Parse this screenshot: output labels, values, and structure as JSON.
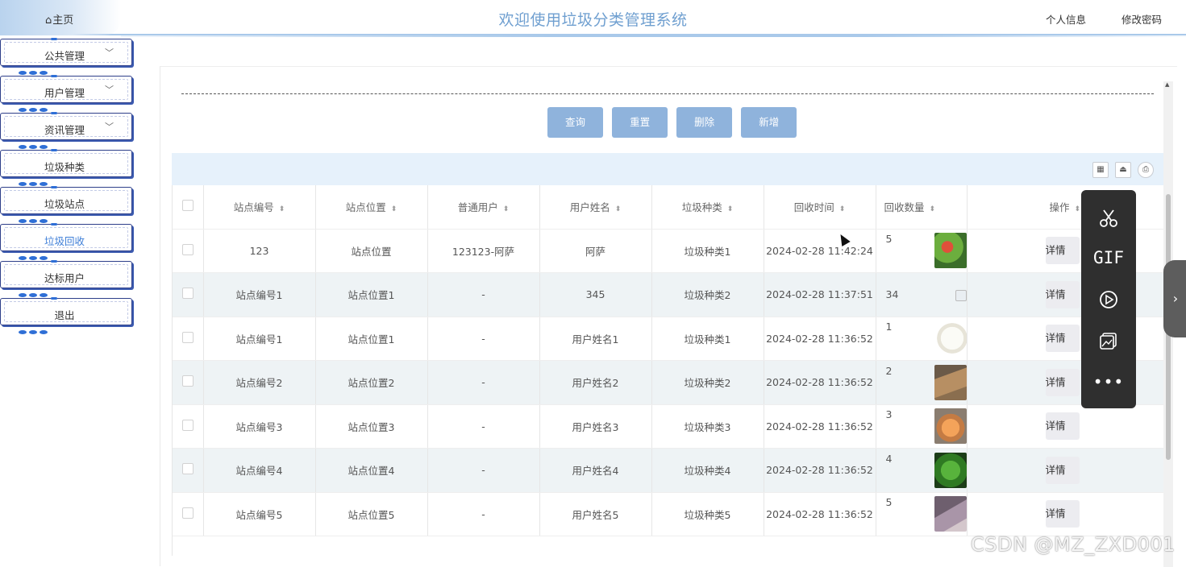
{
  "header": {
    "home_label": "主页",
    "title": "欢迎使用垃圾分类管理系统",
    "profile_label": "个人信息",
    "change_password_label": "修改密码"
  },
  "sidebar": {
    "items": [
      {
        "label": "公共管理",
        "has_submenu": true
      },
      {
        "label": "用户管理",
        "has_submenu": true
      },
      {
        "label": "资讯管理",
        "has_submenu": true
      },
      {
        "label": "垃圾种类",
        "has_submenu": false
      },
      {
        "label": "垃圾站点",
        "has_submenu": false
      },
      {
        "label": "垃圾回收",
        "has_submenu": false,
        "active": true
      },
      {
        "label": "达标用户",
        "has_submenu": false
      },
      {
        "label": "退出",
        "has_submenu": false
      }
    ]
  },
  "actions": {
    "query": "查询",
    "reset": "重置",
    "delete": "删除",
    "add": "新增"
  },
  "table": {
    "columns": [
      "站点编号",
      "站点位置",
      "普通用户",
      "用户姓名",
      "垃圾种类",
      "回收时间",
      "回收数量",
      "操作"
    ],
    "detail_label": "详情",
    "rows": [
      {
        "site_no": "123",
        "site_location": "站点位置",
        "user": "123123-阿萨",
        "user_name": "阿萨",
        "type": "垃圾种类1",
        "time": "2024-02-28 11:42:24",
        "count": "5",
        "image": "vegetables"
      },
      {
        "site_no": "站点编号1",
        "site_location": "站点位置1",
        "user": "-",
        "user_name": "345",
        "type": "垃圾种类2",
        "time": "2024-02-28 11:37:51",
        "count": "34",
        "image": "broken"
      },
      {
        "site_no": "站点编号1",
        "site_location": "站点位置1",
        "user": "-",
        "user_name": "用户姓名1",
        "type": "垃圾种类1",
        "time": "2024-02-28 11:36:52",
        "count": "1",
        "image": "kettle"
      },
      {
        "site_no": "站点编号2",
        "site_location": "站点位置2",
        "user": "-",
        "user_name": "用户姓名2",
        "type": "垃圾种类2",
        "time": "2024-02-28 11:36:52",
        "count": "2",
        "image": "cardboard"
      },
      {
        "site_no": "站点编号3",
        "site_location": "站点位置3",
        "user": "-",
        "user_name": "用户姓名3",
        "type": "垃圾种类3",
        "time": "2024-02-28 11:36:52",
        "count": "3",
        "image": "eggshell"
      },
      {
        "site_no": "站点编号4",
        "site_location": "站点位置4",
        "user": "-",
        "user_name": "用户姓名4",
        "type": "垃圾种类4",
        "time": "2024-02-28 11:36:52",
        "count": "4",
        "image": "greens"
      },
      {
        "site_no": "站点编号5",
        "site_location": "站点位置5",
        "user": "-",
        "user_name": "用户姓名5",
        "type": "垃圾种类5",
        "time": "2024-02-28 11:36:52",
        "count": "5",
        "image": "bin"
      }
    ]
  },
  "float_panel": {
    "gif_label": "GIF"
  },
  "watermark": "CSDN @MZ_ZXD001",
  "colors": {
    "accent": "#8fb3dc",
    "title": "#6f9fd0",
    "active_menu": "#3f7fd8",
    "toolbar_bg": "#e6f1fb",
    "row_stripe": "#eef3f5"
  }
}
